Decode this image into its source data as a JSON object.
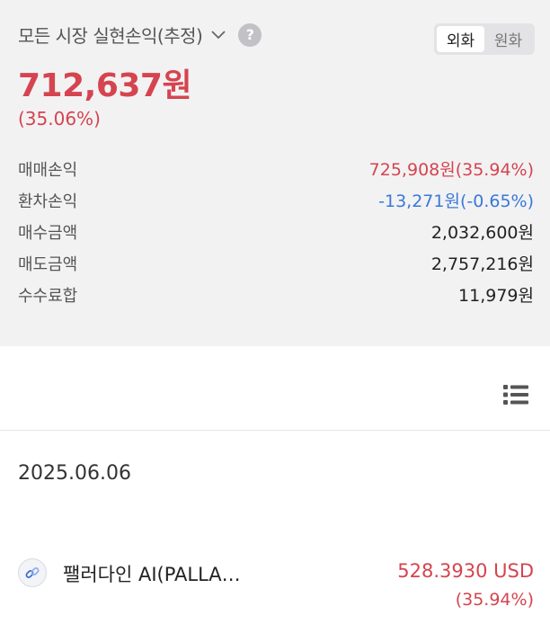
{
  "summary": {
    "title": "모든 시장 실현손익(추정)",
    "help_symbol": "?",
    "currency_toggle": {
      "options": [
        "외화",
        "원화"
      ],
      "selected": "외화"
    },
    "total_amount": "712,637원",
    "total_pct": "(35.06%)",
    "rows": [
      {
        "label": "매매손익",
        "value": "725,908원(35.94%)",
        "tone": "red"
      },
      {
        "label": "환차손익",
        "value": "-13,271원(-0.65%)",
        "tone": "blue"
      },
      {
        "label": "매수금액",
        "value": "2,032,600원",
        "tone": "default"
      },
      {
        "label": "매도금액",
        "value": "2,757,216원",
        "tone": "default"
      },
      {
        "label": "수수료합",
        "value": "11,979원",
        "tone": "default"
      }
    ]
  },
  "list": {
    "date": "2025.06.06",
    "items": [
      {
        "name": "팰러다인 AI(PALLA…",
        "amount": "528.3930 USD",
        "pct": "(35.94%)",
        "icon": "chain-link-icon"
      }
    ]
  },
  "colors": {
    "profit": "#d5444f",
    "loss": "#3b78d8",
    "summary_bg": "#f2f2f3"
  }
}
